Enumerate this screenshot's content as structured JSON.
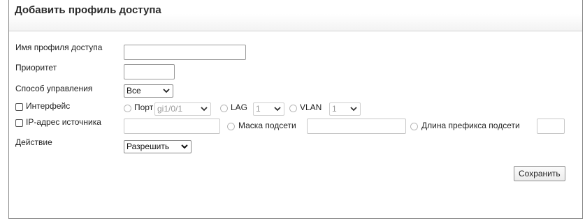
{
  "form": {
    "title": "Добавить профиль доступа",
    "profile_name": {
      "label": "Имя профиля доступа",
      "value": ""
    },
    "priority": {
      "label": "Приоритет",
      "value": ""
    },
    "management_method": {
      "label": "Способ управления",
      "selected": "Все"
    },
    "interface": {
      "label": "Интерфейс",
      "checked": false,
      "port": {
        "label": "Порт",
        "selected": "gi1/0/1"
      },
      "lag": {
        "label": "LAG",
        "selected": "1"
      },
      "vlan": {
        "label": "VLAN",
        "selected": "1"
      }
    },
    "source_ip": {
      "label": "IP-адрес источника",
      "checked": false,
      "value": "",
      "subnet_mask": {
        "label": "Маска подсети",
        "value": ""
      },
      "prefix_length": {
        "label": "Длина префикса подсети",
        "value": ""
      }
    },
    "action": {
      "label": "Действие",
      "selected": "Разрешить"
    },
    "save_label": "Сохранить"
  }
}
